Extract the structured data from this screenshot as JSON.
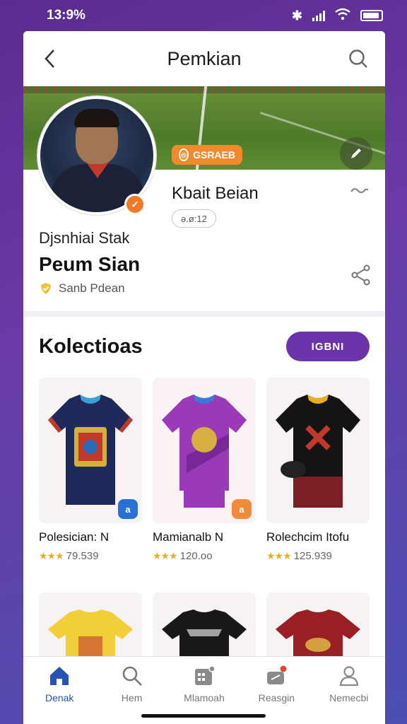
{
  "status_bar": {
    "time": "13:9%"
  },
  "header": {
    "title": "Pemkian"
  },
  "profile": {
    "badge_label": "GSRAEB",
    "right_name": "Kbait Beian",
    "id_pill": "ə.ø:12",
    "subtitle": "Djsnhiai Stak",
    "name": "Peum Sian",
    "location": "Sanb Pdean"
  },
  "collections": {
    "title": "Kolectioas",
    "button_label": "IGBNI",
    "items": [
      {
        "title": "Polesician: N",
        "rating": "79.539",
        "badge": "a"
      },
      {
        "title": "Mamianalb N",
        "rating": "120.oo",
        "badge": "a"
      },
      {
        "title": "Rolechcim Itofu",
        "rating": "125.939",
        "badge": ""
      }
    ]
  },
  "bottom_nav": {
    "items": [
      {
        "label": "Denak",
        "icon": "home-icon"
      },
      {
        "label": "Hem",
        "icon": "search-icon"
      },
      {
        "label": "Mlamoah",
        "icon": "calendar-icon"
      },
      {
        "label": "Reasgin",
        "icon": "gift-icon"
      },
      {
        "label": "Nemecbi",
        "icon": "profile-icon"
      }
    ]
  },
  "colors": {
    "accent": "#6b34a8",
    "orange": "#f07a2a",
    "active_nav": "#2854b8"
  }
}
